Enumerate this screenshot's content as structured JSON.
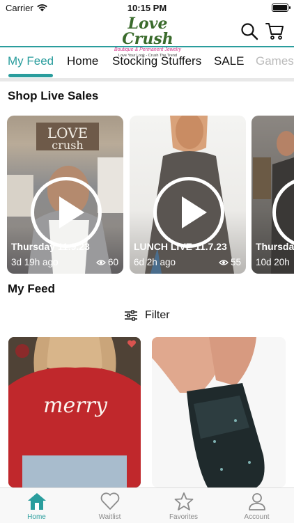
{
  "status_bar": {
    "carrier": "Carrier",
    "time": "10:15 PM"
  },
  "header": {
    "logo_line1": "Love Crush",
    "logo_line2": "Boutique & Permanent Jewelry",
    "logo_line3": "Love Your Look - Crush The Trend"
  },
  "tabs": [
    {
      "label": "My Feed"
    },
    {
      "label": "Home"
    },
    {
      "label": "Stocking Stuffers"
    },
    {
      "label": "SALE"
    },
    {
      "label": "Games"
    }
  ],
  "live_sales": {
    "title": "Shop Live Sales",
    "cards": [
      {
        "title": "Thursday 11.9.23",
        "ago": "3d 19h ago",
        "views": "60"
      },
      {
        "title": "LUNCH LIVE 11.7.23",
        "ago": "6d 2h ago",
        "views": "55"
      },
      {
        "title": "Thursday",
        "ago": "10d 20h",
        "views": ""
      }
    ]
  },
  "feed": {
    "title": "My Feed",
    "filter_label": "Filter",
    "card1_text": "merry"
  },
  "bottom_nav": [
    {
      "label": "Home"
    },
    {
      "label": "Waitlist"
    },
    {
      "label": "Favorites"
    },
    {
      "label": "Account"
    }
  ],
  "colors": {
    "accent": "#2a9d9d",
    "brand_pink": "#d1338a",
    "brand_green": "#3a6b2c",
    "sweater_red": "#c0282c"
  }
}
